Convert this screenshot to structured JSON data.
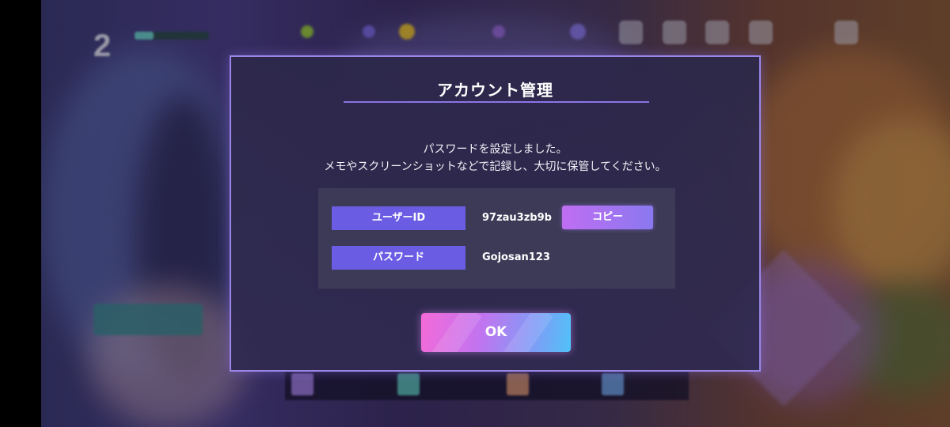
{
  "dialog": {
    "title": "アカウント管理",
    "message_line1": "パスワードを設定しました。",
    "message_line2": "メモやスクリーンショットなどで記録し、大切に保管してください。",
    "user_id_label": "ユーザーID",
    "user_id_value": "97zau3zb9b",
    "copy_label": "コピー",
    "password_label": "パスワード",
    "password_value": "Gojosan123",
    "ok_label": "OK"
  },
  "hud": {
    "rank": "2",
    "exp_progress": 0.25
  },
  "colors": {
    "dialog_border": "#9b86e8",
    "label_box": "#6a5de4",
    "copy_button": "#c06ef2",
    "ok_gradient_start": "#f46ad8",
    "ok_gradient_end": "#50c2f8"
  },
  "icons": [
    "ticket-icon",
    "notice-icon",
    "present-icon",
    "profile-icon",
    "menu-icon"
  ]
}
